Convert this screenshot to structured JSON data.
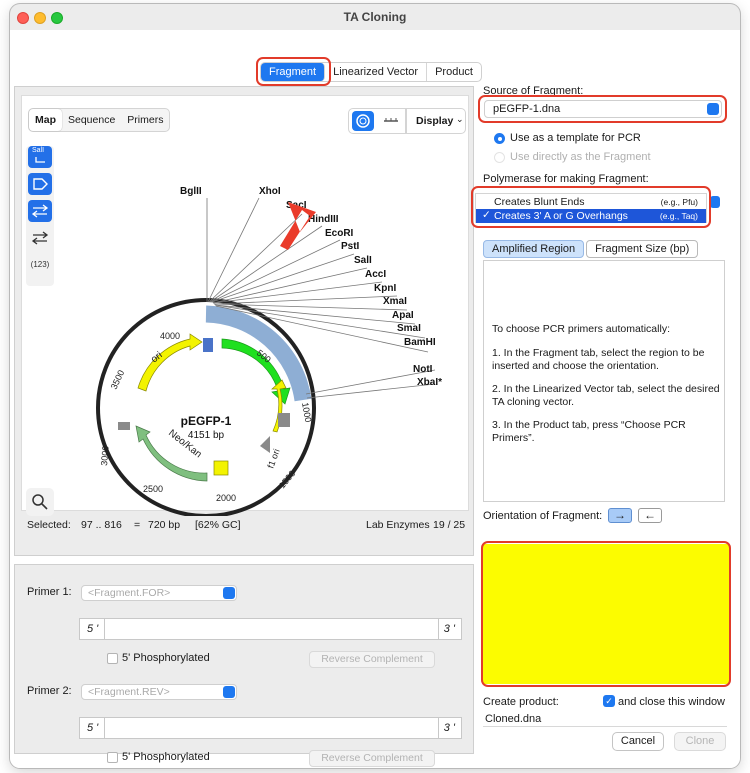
{
  "window": {
    "title": "TA Cloning"
  },
  "tabs": [
    {
      "label": "Fragment",
      "active": true
    },
    {
      "label": "Linearized Vector",
      "active": false
    },
    {
      "label": "Product",
      "active": false
    }
  ],
  "map_view": {
    "view_tabs": [
      "Map",
      "Sequence",
      "Primers"
    ],
    "display_label": "Display",
    "tool_count_badge": "(123)",
    "tool_sali_label": "SalI",
    "plasmid_name": "pEGFP-1",
    "plasmid_size": "4151 bp",
    "enzymes": [
      "BglII",
      "XhoI",
      "SacI",
      "HindIII",
      "EcoRI",
      "PstI",
      "SalI",
      "AccI",
      "KpnI",
      "XmaI",
      "ApaI",
      "SmaI",
      "BamHI",
      "NotI",
      "XbaI*"
    ],
    "features": [
      "ori",
      "Neo/Kan",
      "f1 ori"
    ],
    "ticks": [
      "500",
      "1000",
      "1500",
      "2000",
      "2500",
      "3000",
      "3500",
      "4000"
    ],
    "status": {
      "selected_label": "Selected:",
      "selected_range": "97 .. 816",
      "equals": "=",
      "length": "720 bp",
      "gc": "[62% GC]",
      "enzymes_label": "Lab Enzymes",
      "enzymes_count": "19 / 25"
    }
  },
  "primers": {
    "primer1_label": "Primer 1:",
    "primer1_placeholder": "<Fragment.FOR>",
    "primer2_label": "Primer 2:",
    "primer2_placeholder": "<Fragment.REV>",
    "five_prime": "5 '",
    "three_prime": "3 '",
    "phosphorylated_label": "5' Phosphorylated",
    "reverse_complement_label": "Reverse Complement"
  },
  "source": {
    "label": "Source of Fragment:",
    "value": "pEGFP-1.dna",
    "options": [
      {
        "label": "Use as a template for PCR",
        "selected": true,
        "enabled": true
      },
      {
        "label": "Use directly as the Fragment",
        "selected": false,
        "enabled": false
      }
    ]
  },
  "polymerase": {
    "label": "Polymerase for making Fragment:",
    "items": [
      {
        "name": "Creates Blunt Ends",
        "example": "(e.g., Pfu)",
        "selected": false
      },
      {
        "name": "Creates 3' A or G Overhangs",
        "example": "(e.g., Taq)",
        "selected": true
      }
    ],
    "check_mark": "✓"
  },
  "region_tabs": [
    "Amplified Region",
    "Fragment Size (bp)"
  ],
  "instructions": [
    "To choose PCR primers automatically:",
    "1. In the Fragment tab, select the region to be inserted and choose the orientation.",
    "2. In the Linearized Vector tab, select the desired TA cloning vector.",
    "3. In the Product tab, press “Choose PCR Primers”."
  ],
  "orientation": {
    "label": "Orientation of Fragment:",
    "forward": "→",
    "reverse": "←"
  },
  "product": {
    "create_label": "Create product:",
    "close_label": "and close this window",
    "close_checked": true,
    "name_value": "Cloned.dna",
    "cancel_label": "Cancel",
    "clone_label": "Clone"
  },
  "colors": {
    "accent": "#1e78f0",
    "highlight_ring": "#e23b2a",
    "preview": "#fcfc00"
  }
}
